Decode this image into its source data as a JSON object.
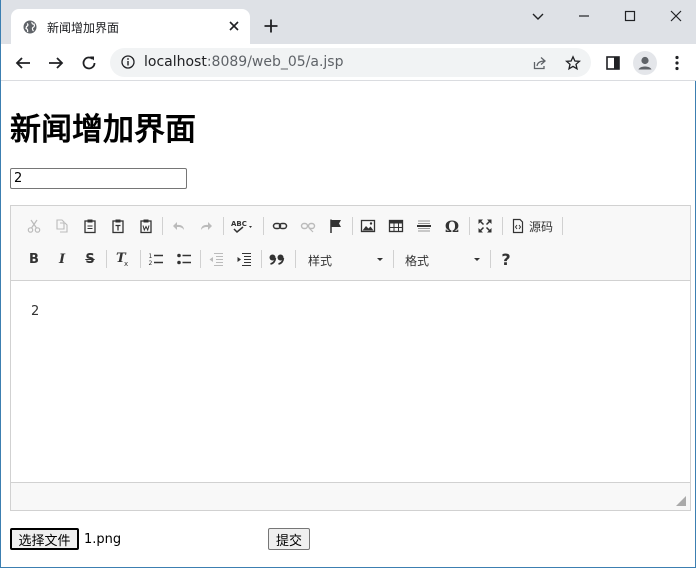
{
  "browser": {
    "tab_title": "新闻增加界面",
    "url_host": "localhost",
    "url_path": ":8089/web_05/a.jsp"
  },
  "page": {
    "heading": "新闻增加界面",
    "title_input_value": "2"
  },
  "editor": {
    "toolbar_row1": [
      "cut-icon",
      "copy-icon",
      "paste-icon",
      "paste-text-icon",
      "paste-word-icon",
      "undo-icon",
      "redo-icon",
      "spellcheck-icon",
      "link-icon",
      "unlink-icon",
      "anchor-icon",
      "image-icon",
      "table-icon",
      "horizontal-rule-icon",
      "special-char-icon",
      "maximize-icon",
      "source-icon"
    ],
    "source_label": "源码",
    "toolbar_row2": [
      "bold-icon",
      "italic-icon",
      "strike-icon",
      "remove-format-icon",
      "numbered-list-icon",
      "bulleted-list-icon",
      "outdent-icon",
      "indent-icon",
      "blockquote-icon",
      "help-icon"
    ],
    "styles_combo": "样式",
    "format_combo": "格式",
    "content": "2"
  },
  "form": {
    "file_button": "选择文件",
    "file_name": "1.png",
    "submit_button": "提交"
  },
  "colors": {
    "tabstrip_bg": "#dee1e6",
    "omnibox_bg": "#f1f3f4",
    "editor_toolbar_bg": "#f8f8f8",
    "editor_border": "#d1d1d1",
    "window_border": "#3c7fb1"
  }
}
